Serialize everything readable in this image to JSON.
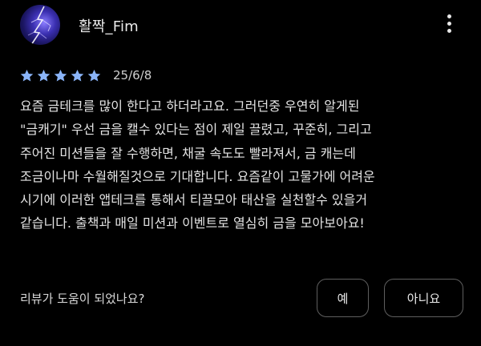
{
  "review": {
    "reviewer_name": "활짝_Fim",
    "avatar": "lightning-avatar",
    "rating": 5,
    "rating_max": 5,
    "date": "25/6/8",
    "body_lines": [
      "요즘 금테크를 많이 한다고 하더라고요. 그러던중 우연히 알게된",
      "\"금캐기\" 우선 금을 캘수 있다는 점이 제일 끌렸고, 꾸준히, 그리고",
      "주어진 미션들을 잘 수행하면, 채굴 속도도 빨라져서, 금 캐는데",
      "조금이나마 수월해질것으로 기대합니다. 요즘같이 고물가에 어려운",
      "시기에 이러한 앱테크를 통해서 티끌모아 태산을 실천할수 있을거",
      "같습니다. 출책과 매일 미션과 이벤트로 열심히 금을 모아보아요!"
    ]
  },
  "helpful": {
    "question": "리뷰가 도움이 되었나요?",
    "yes_label": "예",
    "no_label": "아니요"
  },
  "icons": {
    "more": "more-vert-icon",
    "star": "star-icon"
  },
  "colors": {
    "background": "#000000",
    "star": "#8ab4f8",
    "text": "#e4e4e4",
    "button_border": "#5f5f5f"
  }
}
